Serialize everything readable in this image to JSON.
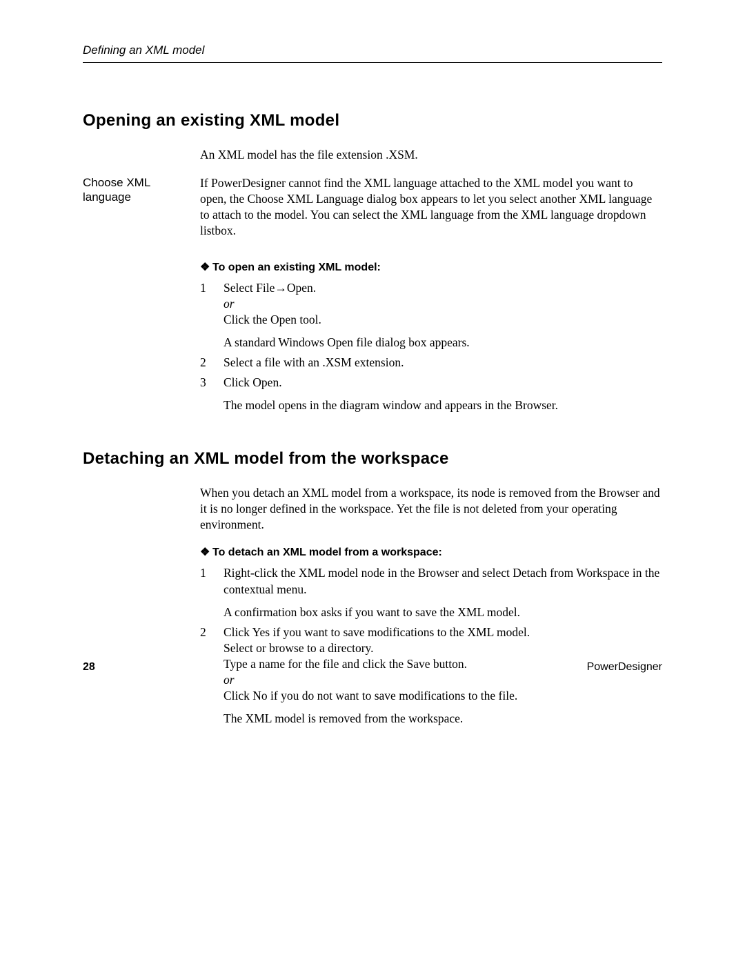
{
  "runningHead": "Defining an XML model",
  "footer": {
    "page": "28",
    "product": "PowerDesigner"
  },
  "s1": {
    "title": "Opening an existing XML model",
    "intro": "An XML model has the file extension .XSM.",
    "marginNote": "Choose XML language",
    "body": "If PowerDesigner cannot find the XML language attached to the XML model you want to open, the Choose XML Language dialog box appears to let you select another XML language to attach to the model. You can select the XML language from the XML language dropdown listbox.",
    "procHead": "To open an existing XML model:",
    "step1": {
      "num": "1",
      "a": "Select File→Open.",
      "or": "or",
      "b": "Click the Open tool.",
      "c": "A standard Windows Open file dialog box appears."
    },
    "step2": {
      "num": "2",
      "a": "Select a file with an .XSM extension."
    },
    "step3": {
      "num": "3",
      "a": "Click Open.",
      "b": "The model opens in the diagram window and appears in the Browser."
    }
  },
  "s2": {
    "title": "Detaching an XML model from the workspace",
    "intro": "When you detach an XML model from a workspace, its node is removed from the Browser and it is no longer defined in the workspace. Yet the file is not deleted from your operating environment.",
    "procHead": "To detach an XML model from a workspace:",
    "step1": {
      "num": "1",
      "a": "Right-click the XML model node in the Browser and select Detach from Workspace in the contextual menu.",
      "b": "A confirmation box asks if you want to save the XML model."
    },
    "step2": {
      "num": "2",
      "a": "Click Yes if you want to save modifications to the XML model.",
      "b": "Select or browse to a directory.",
      "c": "Type a name for the file and click the Save button.",
      "or": "or",
      "d": "Click No if you do not want to save modifications to the file.",
      "e": "The XML model is removed from the workspace."
    }
  }
}
